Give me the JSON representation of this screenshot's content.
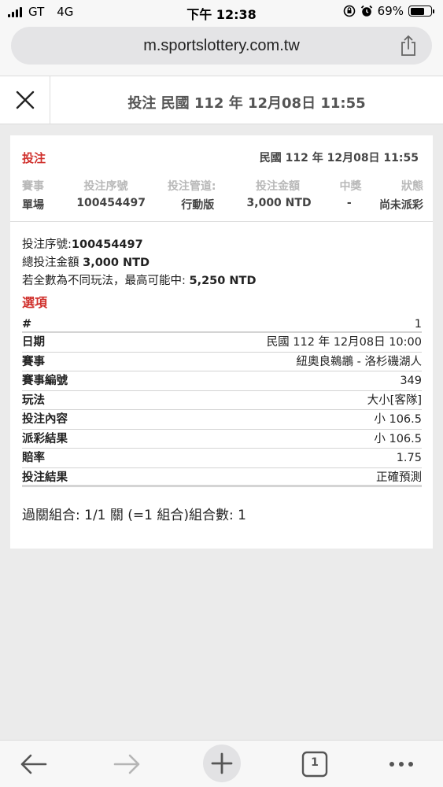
{
  "status_bar": {
    "carrier": "GT",
    "network": "4G",
    "time": "下午 12:38",
    "battery": "69%",
    "battery_level": 0.69
  },
  "browser": {
    "url": "m.sportslottery.com.tw",
    "tab_count": "1"
  },
  "header": {
    "title": "投注 民國 112 年 12月08日 11:55"
  },
  "bet": {
    "label": "投注",
    "date": "民國 112 年 12月08日 11:55",
    "summary_headers": [
      "賽事",
      "投注序號",
      "投注管道:",
      "投注金額",
      "中獎",
      "狀態"
    ],
    "summary_values": [
      "單場",
      "100454497",
      "行動版",
      "3,000 NTD",
      "-",
      "尚未派彩"
    ],
    "serial_label": "投注序號:",
    "serial_value": "100454497",
    "total_label": "總投注金額 ",
    "total_value": "3,000 NTD",
    "max_label": "若全數為不同玩法，最高可能中: ",
    "max_value": "5,250 NTD",
    "options_title": "選項",
    "options": [
      {
        "key": "#",
        "value": "1"
      },
      {
        "key": "日期",
        "value": "民國 112 年 12月08日 10:00"
      },
      {
        "key": "賽事",
        "value": "紐奧良鵜鶘 - 洛杉磯湖人"
      },
      {
        "key": "賽事編號",
        "value": "349"
      },
      {
        "key": "玩法",
        "value": "大小[客隊]"
      },
      {
        "key": "投注內容",
        "value": "小 106.5"
      },
      {
        "key": "派彩結果",
        "value": "小 106.5"
      },
      {
        "key": "賠率",
        "value": "1.75"
      },
      {
        "key": "投注結果",
        "value": "正確預測"
      }
    ],
    "parlay": "過關組合: 1/1 關 (=1 組合)組合數: 1"
  },
  "icons": {
    "close": "close-icon",
    "share": "share-icon",
    "back": "arrow-left-icon",
    "forward": "arrow-right-icon",
    "new_tab": "plus-icon",
    "tabs": "tabs-icon",
    "more": "more-icon"
  },
  "colors": {
    "accent_red": "#d0312d",
    "background": "#ebebeb"
  }
}
